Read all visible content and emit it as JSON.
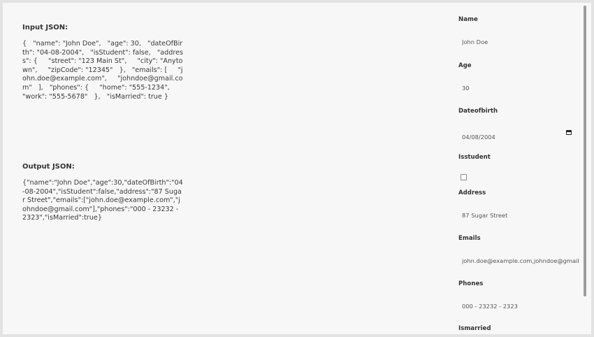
{
  "input_section": {
    "title": "Input JSON:",
    "json": "{   \"name\": \"John Doe\",   \"age\": 30,   \"dateOfBirth\": \"04-08-2004\",   \"isStudent\": false,   \"address\": {     \"street\": \"123 Main St\",     \"city\": \"Anytown\",     \"zipCode\": \"12345\"   },   \"emails\": [     \"john.doe@example.com\",     \"johndoe@gmail.com\"   ],   \"phones\": {     \"home\": \"555-1234\",     \"work\": \"555-5678\"   },   \"isMarried\": true }"
  },
  "output_section": {
    "title": "Output JSON:",
    "json": "{\"name\":\"John Doe\",\"age\":30,\"dateOfBirth\":\"04-08-2004\",\"isStudent\":false,\"address\":\"87 Sugar Street\",\"emails\":[\"john.doe@example.com\",\"johndoe@gmail.com\"],\"phones\":\"000 - 23232 - 2323\",\"isMarried\":true}"
  },
  "form": {
    "name_label": "Name",
    "name_value": "John Doe",
    "age_label": "Age",
    "age_value": "30",
    "dob_label": "Dateofbirth",
    "dob_value": "04/08/2004",
    "isstudent_label": "Isstudent",
    "address_label": "Address",
    "address_value": "87 Sugar Street",
    "emails_label": "Emails",
    "emails_value": "john.doe@example.com,johndoe@gmail.com",
    "phones_label": "Phones",
    "phones_value": "000 - 23232 - 2323",
    "ismarried_label": "Ismarried"
  },
  "icons": {
    "date_picker": "calendar-icon"
  }
}
